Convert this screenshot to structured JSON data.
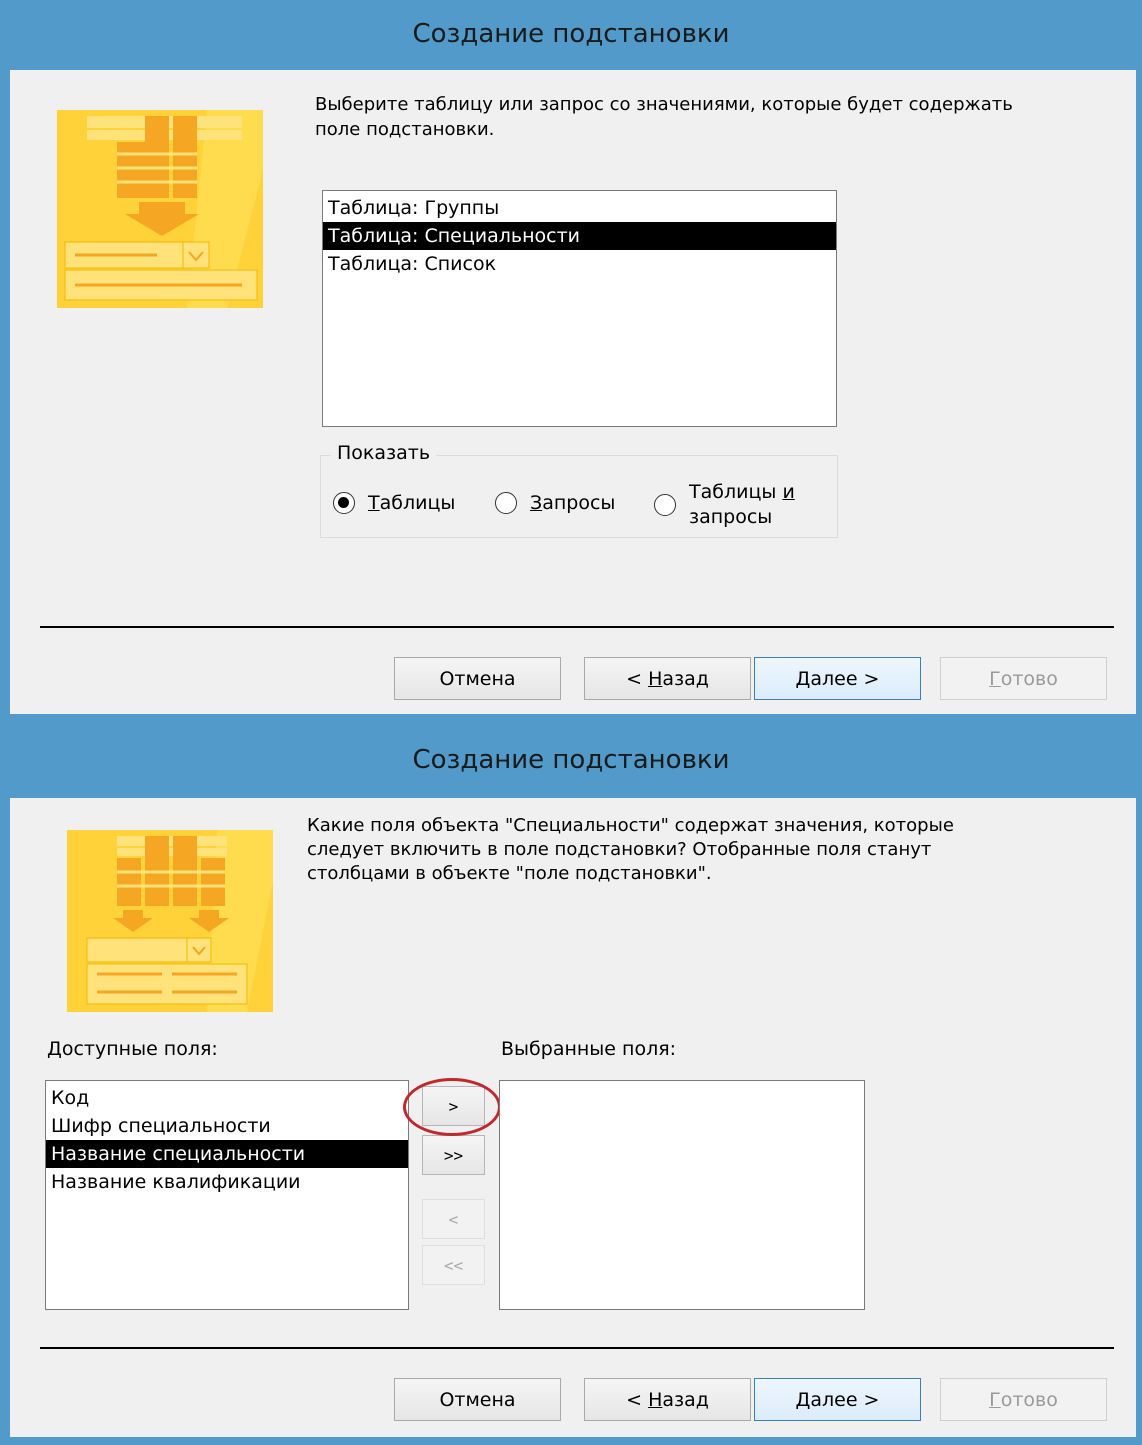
{
  "dialog1": {
    "title": "Создание подстановки",
    "prompt_line1": "Выберите таблицу или запрос со значениями, которые будет содержать",
    "prompt_line2": "поле подстановки.",
    "list_items": [
      "Таблица: Группы",
      "Таблица: Специальности",
      "Таблица: Список"
    ],
    "selected_index": 1,
    "show_group_label": "Показать",
    "radios": [
      {
        "label": "Таблицы",
        "underline": "Т",
        "checked": true
      },
      {
        "label": "Запросы",
        "underline": "З",
        "checked": false
      },
      {
        "label_line1": "Таблицы и",
        "label_line2": "запросы",
        "checked": false
      }
    ],
    "buttons": {
      "cancel": "Отмена",
      "back": "< Назад",
      "next": "Далее >",
      "finish": "Готово"
    }
  },
  "dialog2": {
    "title": "Создание подстановки",
    "prompt_line1": "Какие поля объекта \"Специальности\" содержат значения, которые",
    "prompt_line2": "следует включить в поле подстановки? Отобранные поля станут",
    "prompt_line3": "столбцами в объекте \"поле подстановки\".",
    "available_label": "Доступные поля:",
    "selected_label": "Выбранные поля:",
    "available_fields": [
      "Код",
      "Шифр специальности",
      "Название специальности",
      "Название квалификации"
    ],
    "selected_field_index": 2,
    "move_buttons": {
      "add_one": ">",
      "add_all": ">>",
      "remove_one": "<",
      "remove_all": "<<"
    },
    "buttons": {
      "cancel": "Отмена",
      "back": "< Назад",
      "next": "Далее >",
      "finish": "Готово"
    }
  },
  "colors": {
    "titlebar": "#519ac9",
    "dialog_bg": "#f0f0f0",
    "wizard_icon": "#ffd23a",
    "highlight_ring": "#c0282b"
  }
}
